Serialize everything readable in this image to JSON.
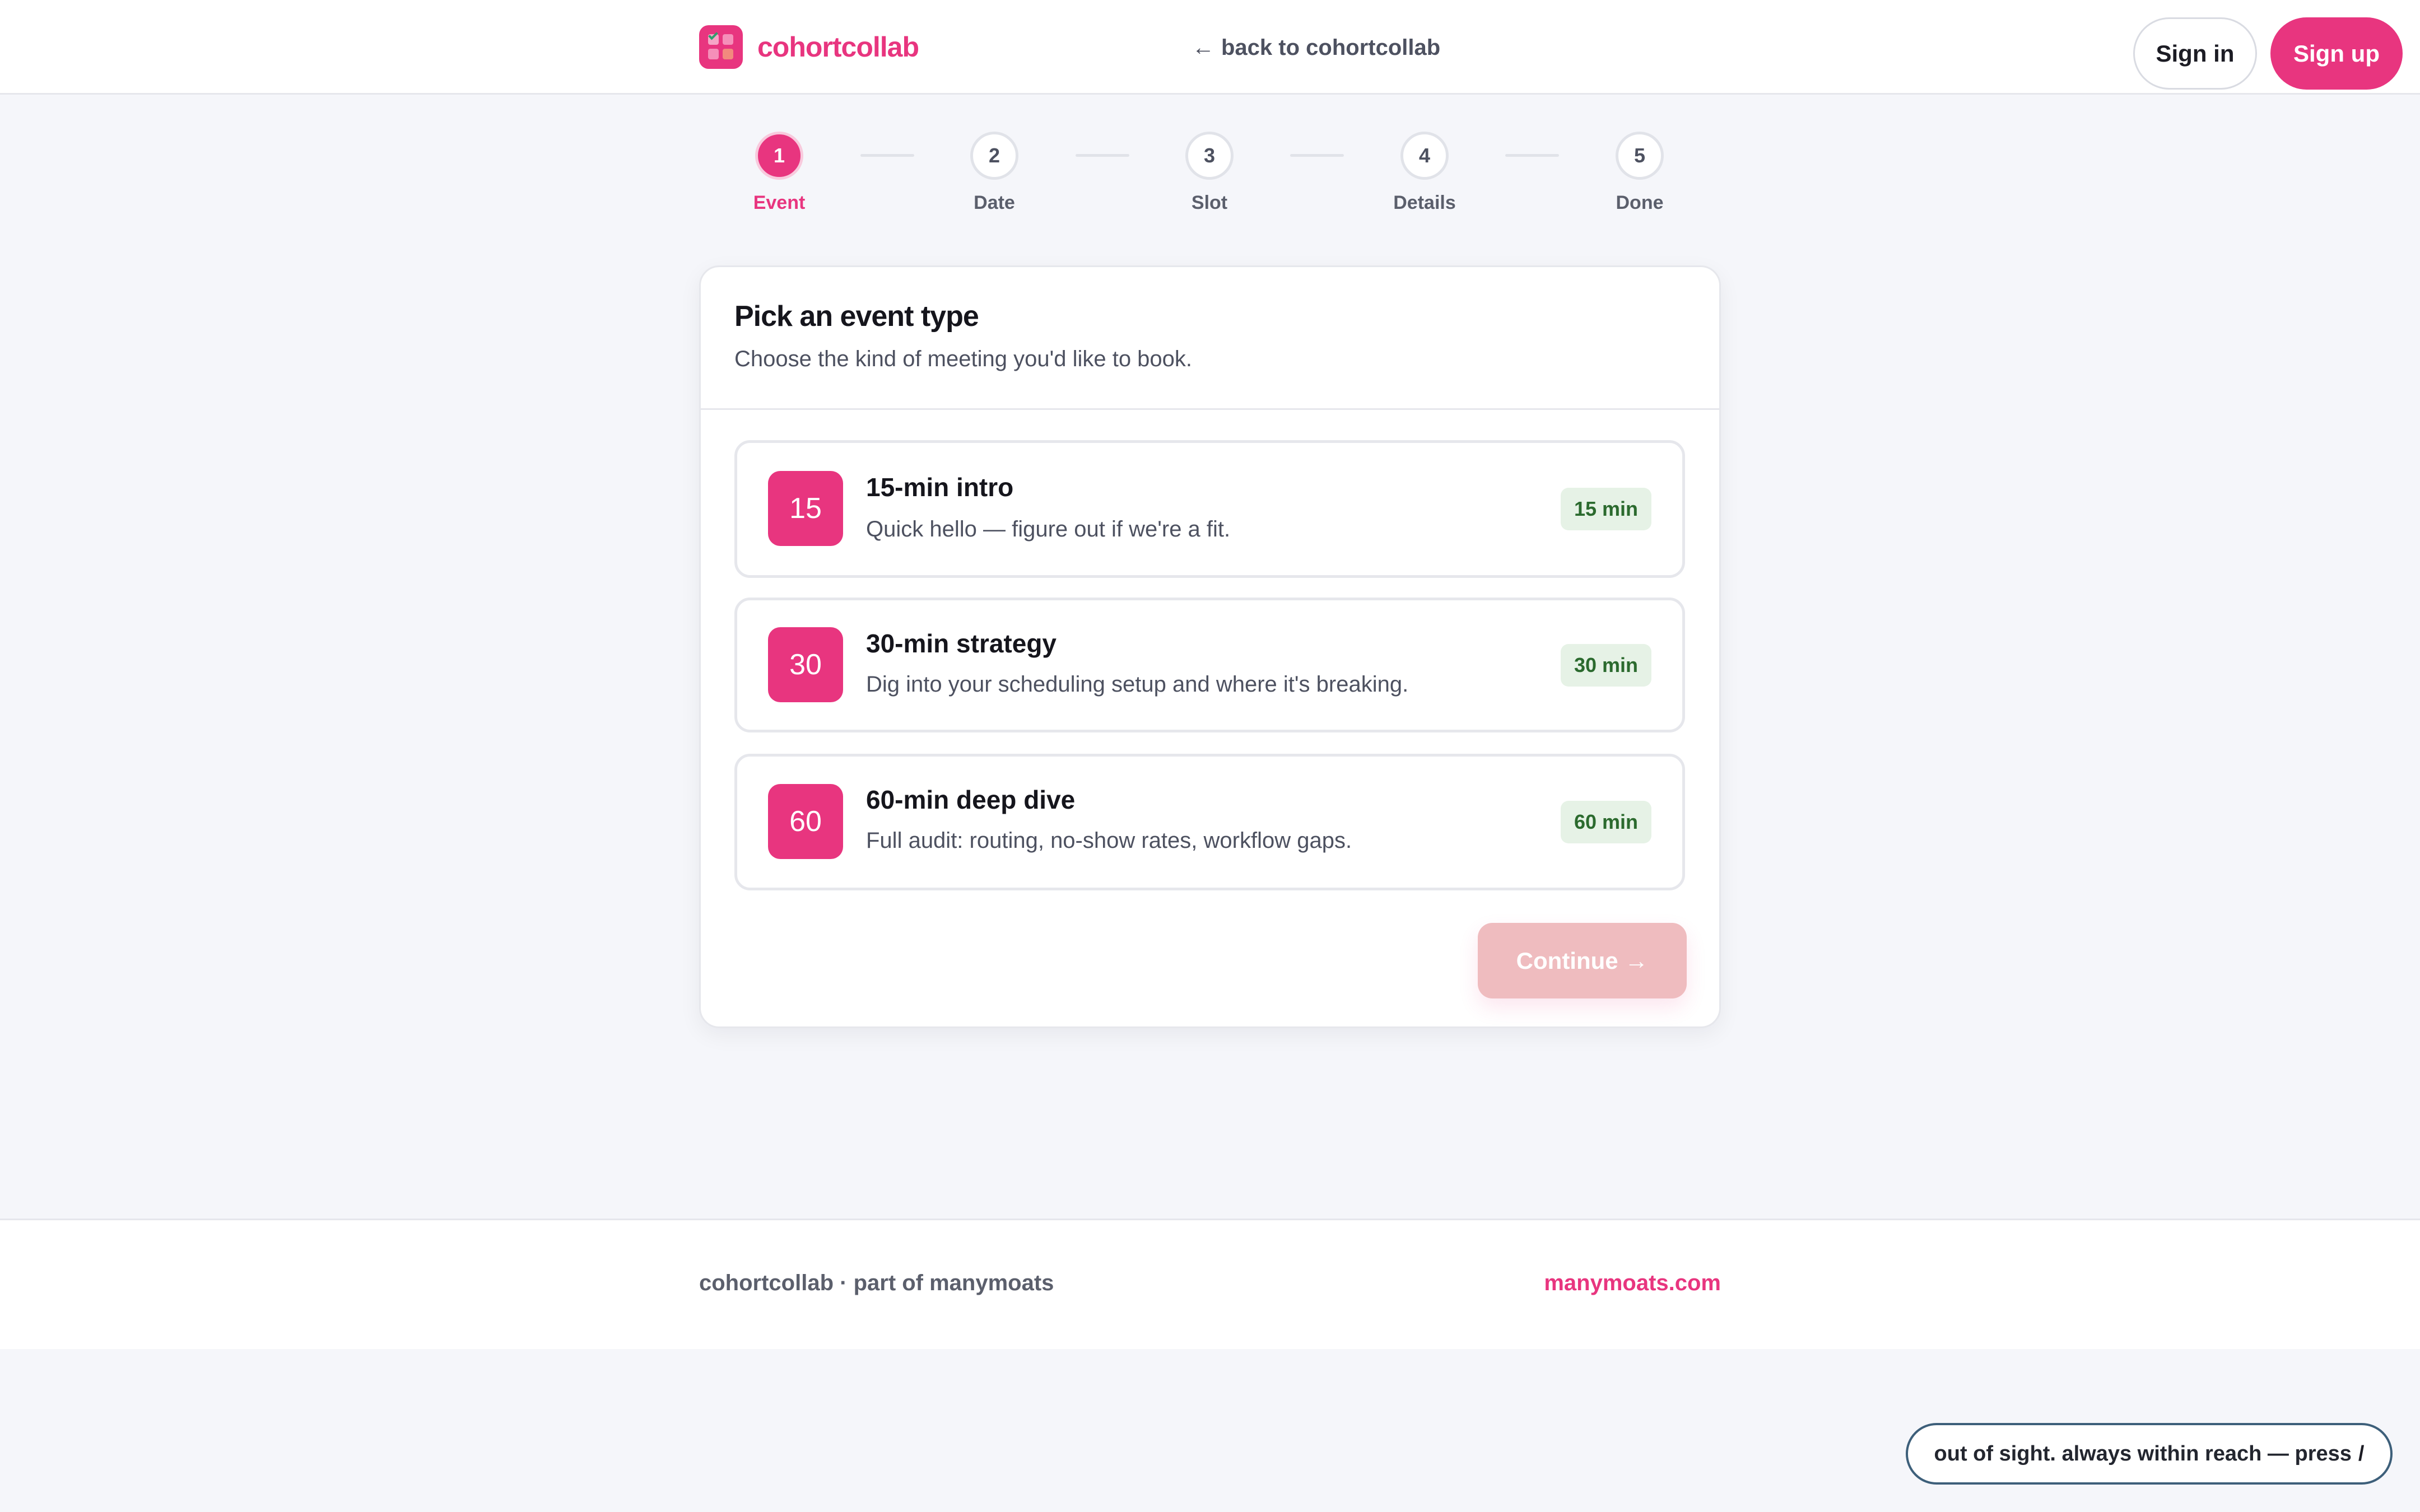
{
  "header": {
    "brand_name": "cohortcollab",
    "back_link": "back to cohortcollab",
    "sign_in": "Sign in",
    "sign_up": "Sign up"
  },
  "stepper": {
    "current_step": 1,
    "steps": [
      {
        "number": "1",
        "label": "Event"
      },
      {
        "number": "2",
        "label": "Date"
      },
      {
        "number": "3",
        "label": "Slot"
      },
      {
        "number": "4",
        "label": "Details"
      },
      {
        "number": "5",
        "label": "Done"
      }
    ]
  },
  "card": {
    "title": "Pick an event type",
    "subtitle": "Choose the kind of meeting you'd like to book.",
    "options": [
      {
        "badge": "15",
        "title": "15-min intro",
        "description": "Quick hello — figure out if we're a fit.",
        "duration": "15 min"
      },
      {
        "badge": "30",
        "title": "30-min strategy",
        "description": "Dig into your scheduling setup and where it's breaking.",
        "duration": "30 min"
      },
      {
        "badge": "60",
        "title": "60-min deep dive",
        "description": "Full audit: routing, no-show rates, workflow gaps.",
        "duration": "60 min"
      }
    ],
    "continue_label": "Continue →"
  },
  "footer": {
    "left_text": "cohortcollab · part of manymoats",
    "right_link": "manymoats.com"
  },
  "hint": {
    "text": "out of sight. always within reach — press",
    "key": "/"
  },
  "colors": {
    "accent": "#e8357f",
    "continue_disabled": "#efbcbf",
    "duration_bg": "#e6f2e6",
    "duration_text": "#2b6a2e",
    "page_bg": "#f5f6fa"
  },
  "icons": {
    "brand": "app-grid-logo-icon",
    "back": "arrow-left-icon",
    "continue": "arrow-right-icon"
  }
}
